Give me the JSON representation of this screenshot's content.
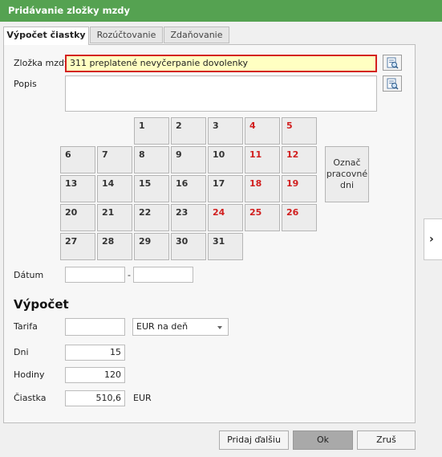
{
  "window": {
    "title": "Pridávanie zložky mzdy"
  },
  "tabs": [
    {
      "label": "Výpočet čiastky",
      "active": true
    },
    {
      "label": "Rozúčtovanie",
      "active": false
    },
    {
      "label": "Zdaňovanie",
      "active": false
    }
  ],
  "form": {
    "component_label": "Zložka mzdy",
    "component_value": "311  preplatené nevyčerpanie dovolenky",
    "description_label": "Popis",
    "description_value": ""
  },
  "calendar": {
    "days": [
      "1",
      "2",
      "3",
      "4",
      "5",
      "6",
      "7",
      "8",
      "9",
      "10",
      "11",
      "12",
      "13",
      "14",
      "15",
      "16",
      "17",
      "18",
      "19",
      "20",
      "21",
      "22",
      "23",
      "24",
      "25",
      "26",
      "27",
      "28",
      "29",
      "30",
      "31"
    ],
    "weekend_days": [
      "4",
      "5",
      "11",
      "12",
      "18",
      "19",
      "24",
      "25",
      "26"
    ],
    "mark_workdays_label": "Označ pracovné dni"
  },
  "date": {
    "label": "Dátum",
    "from": "",
    "to": "",
    "separator": "-"
  },
  "calculation": {
    "heading": "Výpočet",
    "rate_label": "Tarifa",
    "rate_value": "",
    "rate_unit": "EUR na deň",
    "days_label": "Dni",
    "days_value": "15",
    "hours_label": "Hodiny",
    "hours_value": "120",
    "amount_label": "Čiastka",
    "amount_value": "510,6",
    "amount_currency": "EUR"
  },
  "buttons": {
    "add_next": "Pridaj ďalšiu",
    "ok": "Ok",
    "cancel": "Zruš"
  },
  "colors": {
    "title_bar": "#55a251",
    "weekend": "#d11e1e",
    "highlight_border": "#d42020",
    "highlight_fill": "#ffffc2"
  }
}
